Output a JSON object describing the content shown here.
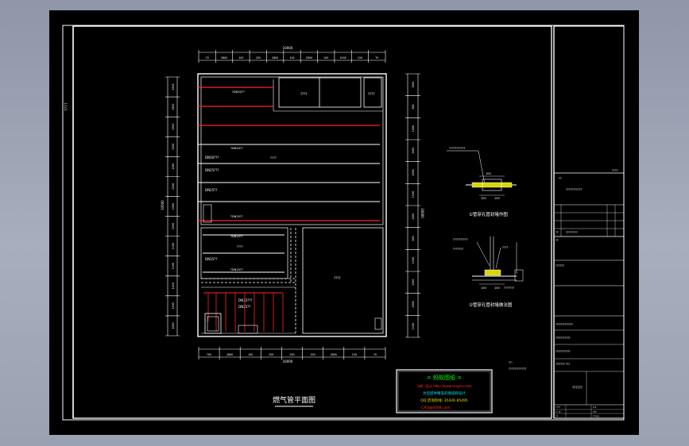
{
  "sheet": {
    "left_margin_code": "????",
    "left_dim_total": "10000",
    "right_dim_total": "10000"
  },
  "plan": {
    "title": "燃气管平面图",
    "top_dim_total": "10000",
    "bottom_dim_total": "10000",
    "top_segments": [
      "70",
      "2800",
      "100",
      "200",
      "2800",
      "100",
      "2800",
      "100",
      "1500",
      "100",
      "70"
    ],
    "bottom_segments": [
      "700",
      "2800",
      "100",
      "200",
      "200",
      "200",
      "2800",
      "100",
      "70"
    ],
    "left_dims": [
      "1500",
      "1500",
      "1500",
      "1200",
      "1200",
      "1200",
      "1500",
      "1200",
      "1200",
      "1200",
      "1200",
      "1200",
      "1000"
    ],
    "right_dims": [
      "1500",
      "800",
      "1000",
      "1500",
      "1500",
      "1500",
      "1500",
      "800",
      "1500",
      "1500",
      "1500",
      "1200"
    ],
    "room_labels": [
      "????",
      "????",
      "????",
      "????",
      "????"
    ],
    "pipe_labels": [
      "DN50???",
      "DN25???",
      "DN25??",
      "DN25??",
      "DN32???",
      "DN25??"
    ],
    "small_labels": [
      "?DN50??",
      "?DN50??",
      "?DN25??",
      "?DN25??",
      "?DN25??",
      "?DN25??",
      "?DN25??",
      "?DN25??"
    ]
  },
  "details": [
    {
      "title": "①管穿孔管封堵作图",
      "label": "???????????",
      "dims": [
        "100",
        "100",
        "100"
      ]
    },
    {
      "title": "②管穿孔管封堵做法图",
      "labels": [
        "??????????",
        "???????",
        "????",
        "???????"
      ],
      "dims": [
        "100",
        "100"
      ]
    }
  ],
  "notes": [
    "??:",
    "????????????"
  ],
  "stamp": {
    "line1": "= 蚂蚁图纸 =",
    "line2": "马蚁--设计  http://www.mayitu.com",
    "line3": "为您提供精美的图纸和设计",
    "line4": "QQ:咨询热线: 35426 85495",
    "line5": "CAD@4008.com"
  },
  "title_block": {
    "top_code": "????",
    "rows": [
      "??",
      "???????????",
      "??",
      "????????",
      "??",
      "??????",
      "?????????????",
      "???????????",
      "???????????",
      "???????  ???",
      "??????"
    ],
    "small": [
      "?:??",
      "1:1",
      "?: ??",
      "???",
      "??",
      "??-01"
    ]
  }
}
